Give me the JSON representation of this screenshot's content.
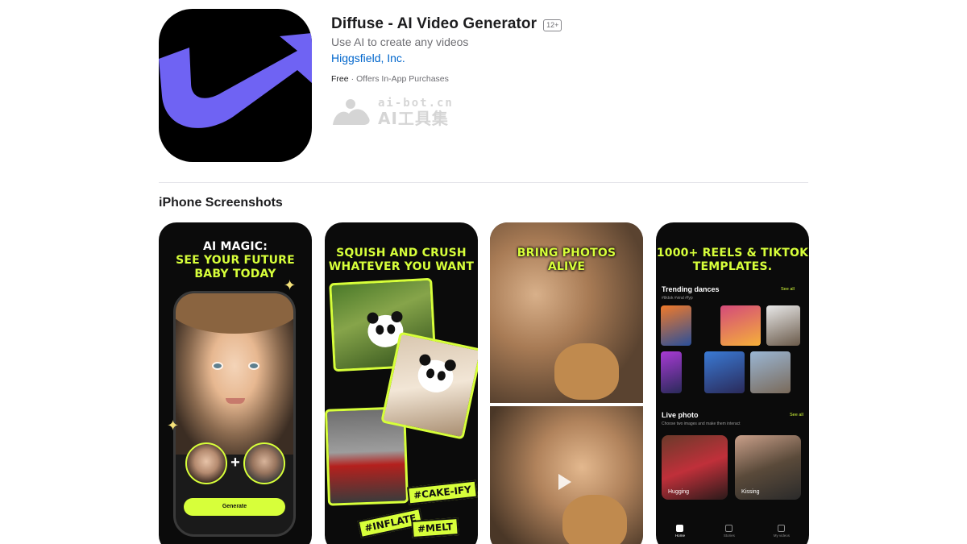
{
  "app": {
    "title": "Diffuse - AI Video Generator",
    "age_rating": "12+",
    "subtitle": "Use AI to create any videos",
    "developer": "Higgsfield, Inc.",
    "price": "Free",
    "separator": "·",
    "iap_note": "Offers In-App Purchases",
    "icon_colors": {
      "background": "#000000",
      "arrow": "#6f63f3"
    }
  },
  "watermark": {
    "line1": "ai-bot.cn",
    "line2": "AI工具集"
  },
  "screenshots_section": {
    "title": "iPhone Screenshots",
    "accent_color": "#d7ff3a",
    "shots": [
      {
        "headline_line1": "AI MAGIC:",
        "headline_line2": "SEE YOUR FUTURE",
        "headline_line3": "BABY TODAY",
        "button": "Generate"
      },
      {
        "headline_line1": "SQUISH AND CRUSH",
        "headline_line2": "WHATEVER YOU WANT",
        "tags": [
          "#CAKE-IFY",
          "#INFLATE",
          "#MELT"
        ]
      },
      {
        "headline_line1": "BRING PHOTOS",
        "headline_line2": "ALIVE"
      },
      {
        "headline_line1": "1000+ REELS & TIKTOK",
        "headline_line2": "TEMPLATES.",
        "trending_title": "Trending dances",
        "trending_tags": "#tiktok #viral #fyp",
        "see_all": "See all",
        "live_title": "Live photo",
        "live_sub": "Choose two images and make them interact",
        "live_items": [
          "Hugging",
          "Kissing"
        ],
        "tabs": [
          "Home",
          "Stories",
          "My videos"
        ]
      }
    ]
  }
}
